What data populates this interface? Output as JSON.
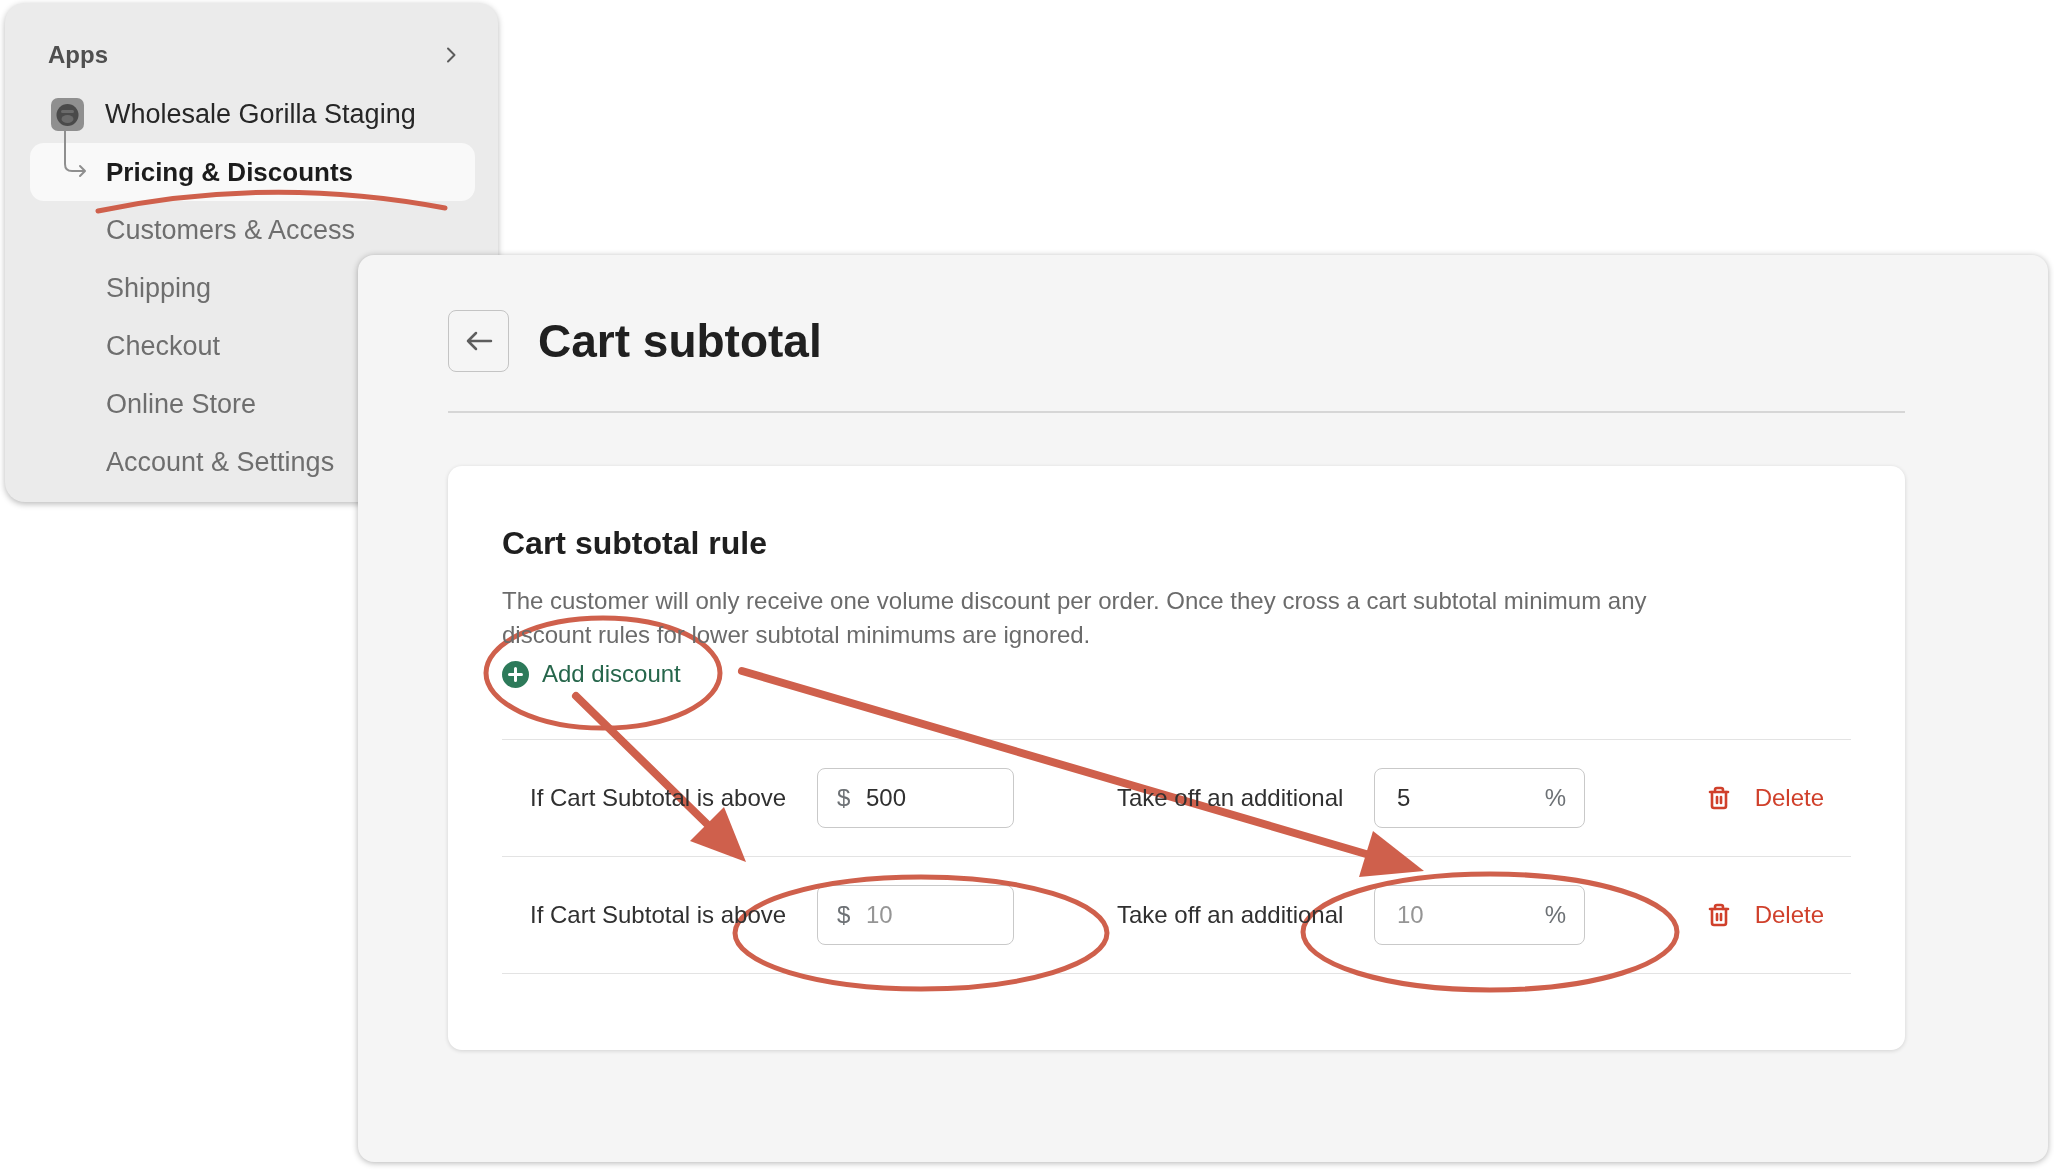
{
  "sidebar": {
    "heading": "Apps",
    "app": {
      "name": "Wholesale Gorilla Staging",
      "children": [
        {
          "label": "Pricing & Discounts",
          "selected": true
        },
        {
          "label": "Customers & Access",
          "selected": false
        },
        {
          "label": "Shipping",
          "selected": false
        },
        {
          "label": "Checkout",
          "selected": false
        },
        {
          "label": "Online Store",
          "selected": false
        },
        {
          "label": "Account & Settings",
          "selected": false
        }
      ]
    }
  },
  "page": {
    "title": "Cart subtotal",
    "card": {
      "title": "Cart subtotal rule",
      "description": "The customer will only receive one volume discount per order. Once they cross a cart subtotal minimum any discount rules for lower subtotal minimums are ignored.",
      "add_button": "Add discount",
      "rules": [
        {
          "condition": "If Cart Subtotal is above",
          "amount": {
            "prefix": "$",
            "value": "500"
          },
          "discount": "Take off an additional",
          "percent": {
            "value": "5",
            "suffix": "%"
          },
          "delete_button": "Delete"
        },
        {
          "condition": "If Cart Subtotal is above",
          "amount": {
            "prefix": "$",
            "placeholder": "10"
          },
          "discount": "Take off an additional",
          "percent": {
            "placeholder": "10",
            "suffix": "%"
          },
          "delete_button": "Delete"
        }
      ]
    }
  }
}
